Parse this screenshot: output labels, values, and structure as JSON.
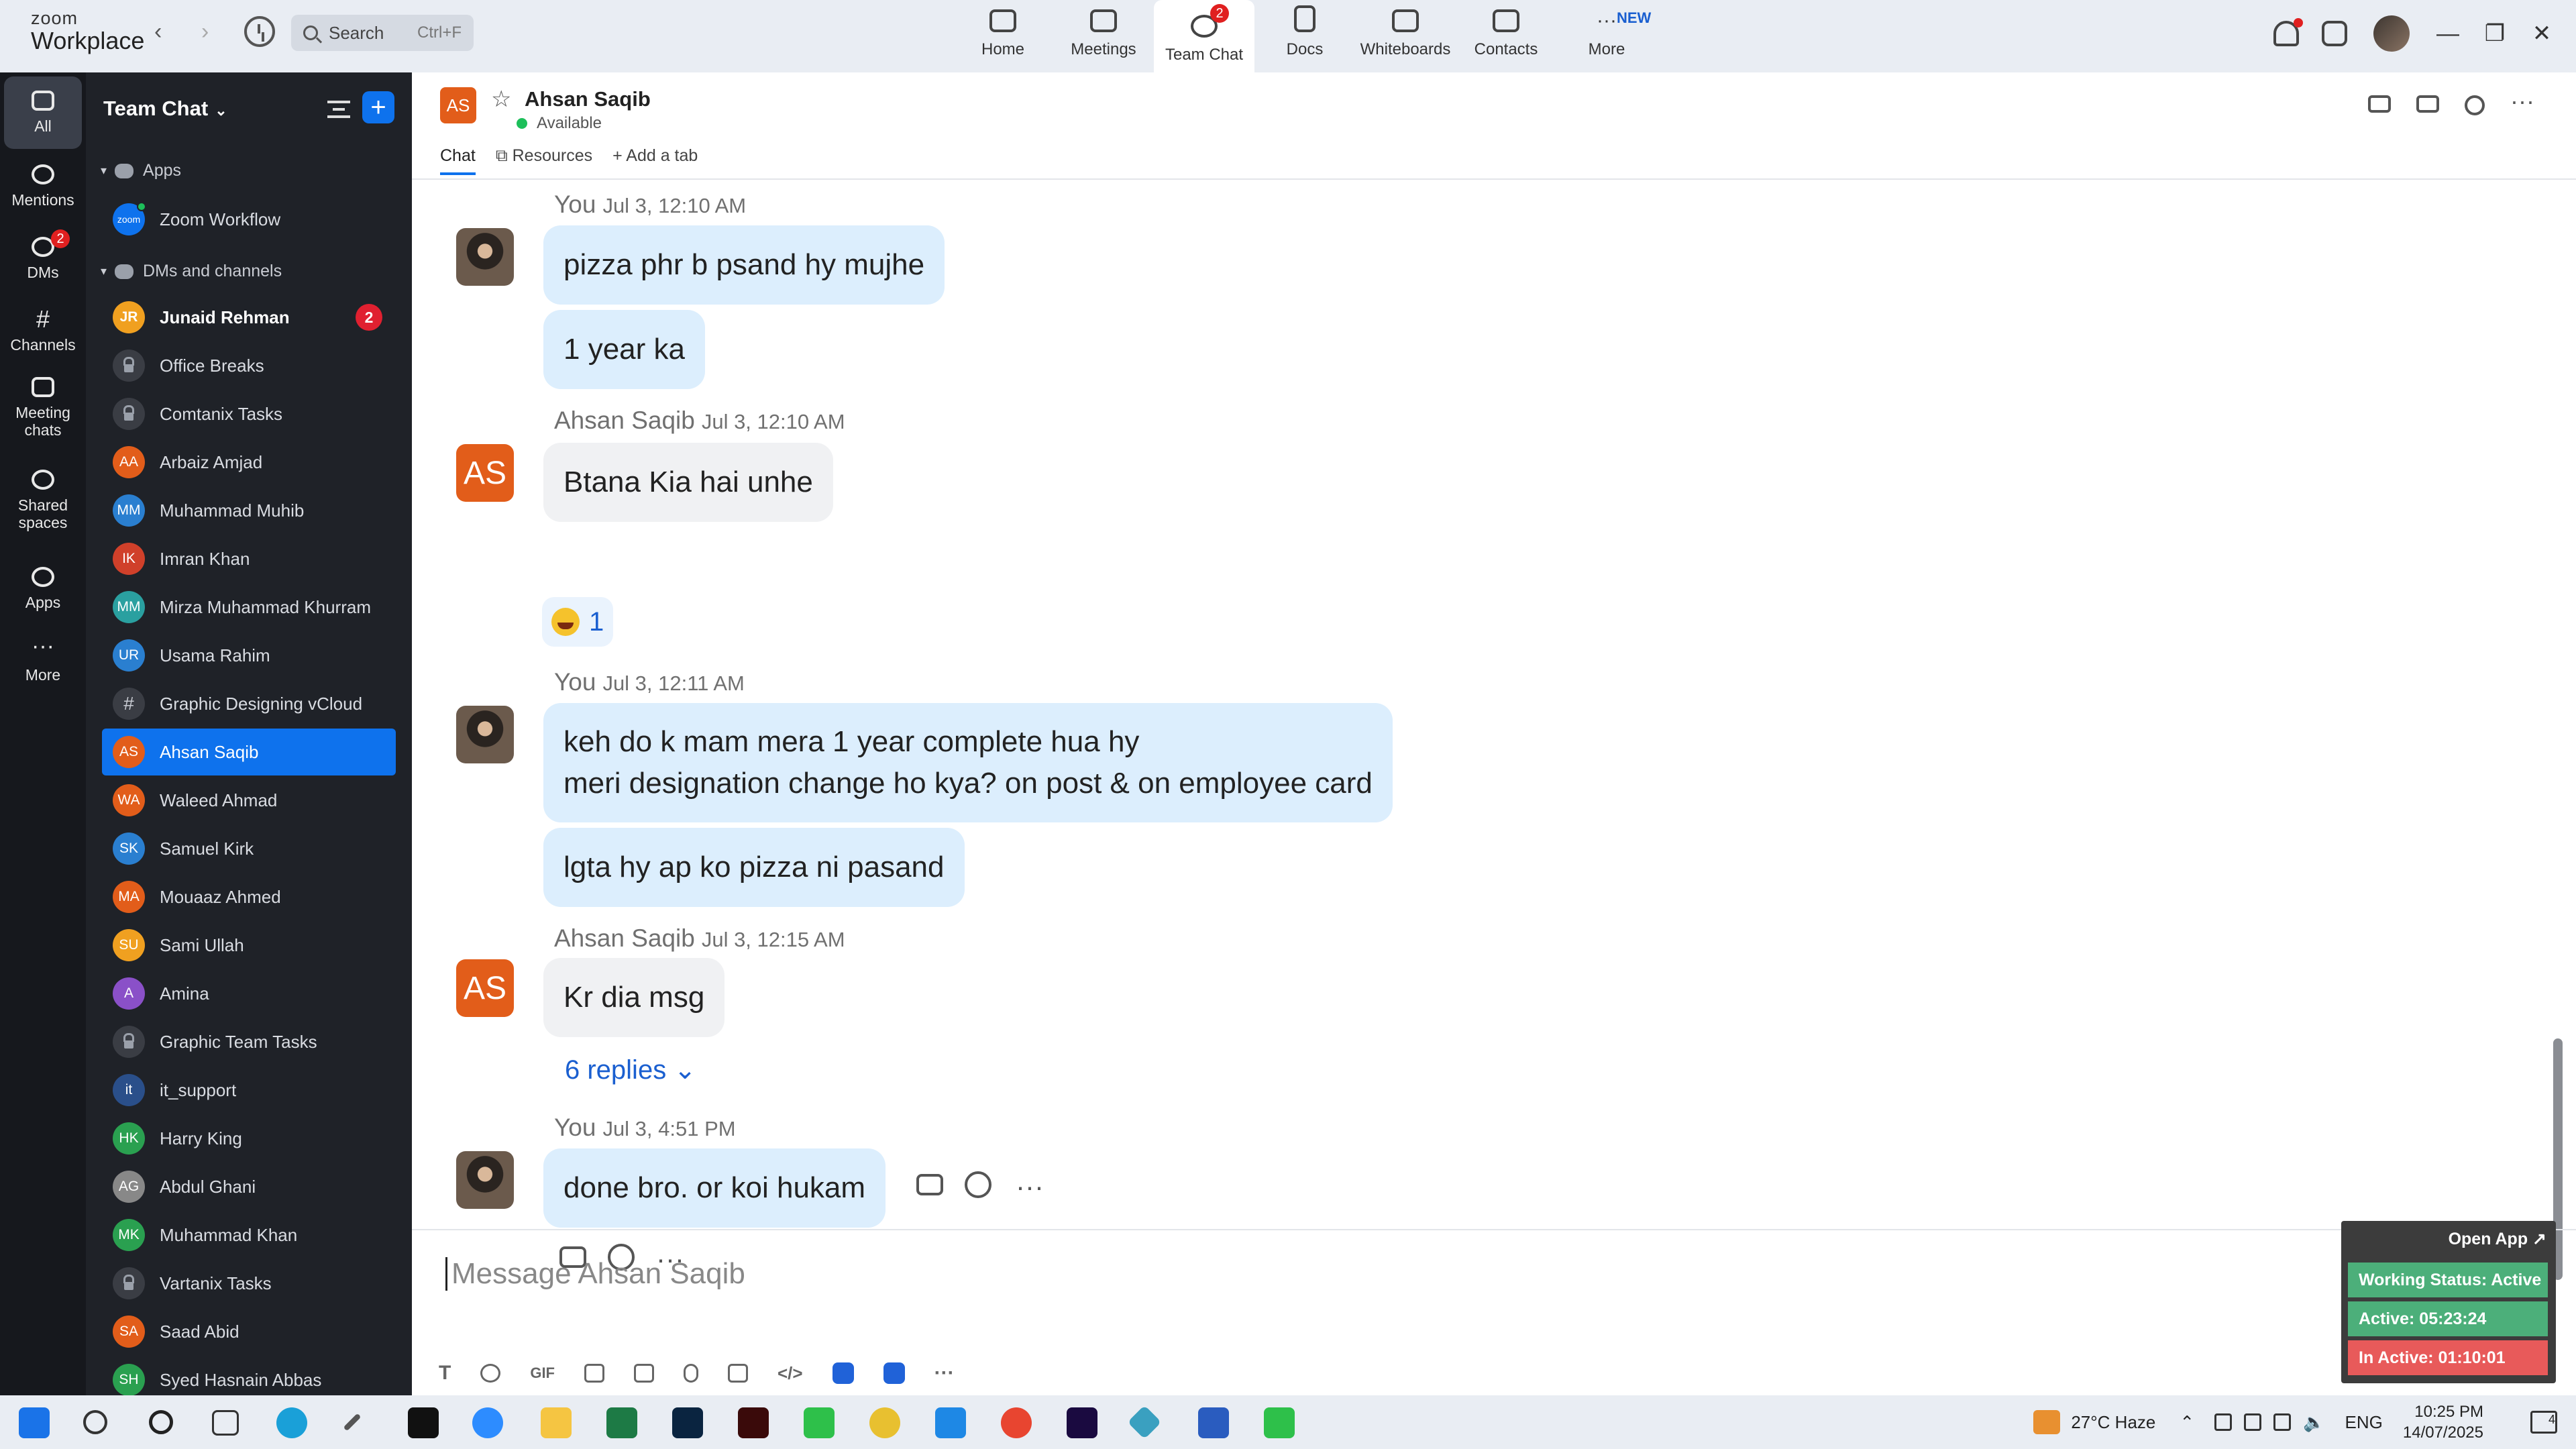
{
  "app": {
    "brand_small": "zoom",
    "brand_large": "Workplace"
  },
  "search": {
    "label": "Search",
    "shortcut": "Ctrl+F"
  },
  "top_tabs": [
    {
      "label": "Home"
    },
    {
      "label": "Meetings"
    },
    {
      "label": "Team Chat",
      "badge": "2"
    },
    {
      "label": "Docs"
    },
    {
      "label": "Whiteboards"
    },
    {
      "label": "Contacts"
    },
    {
      "label": "More",
      "badge": "NEW"
    }
  ],
  "rail": [
    {
      "label": "All"
    },
    {
      "label": "Mentions"
    },
    {
      "label": "DMs",
      "badge": "2"
    },
    {
      "label": "Channels"
    },
    {
      "label": "Meeting chats"
    },
    {
      "label": "Shared spaces"
    },
    {
      "label": "Apps"
    },
    {
      "label": "More"
    }
  ],
  "sidebar": {
    "title": "Team Chat",
    "section_apps": "Apps",
    "app_item": "Zoom Workflow",
    "section_dms": "DMs and channels",
    "items": [
      {
        "name": "Junaid Rehman",
        "initials": "JR",
        "color": "#f0a020",
        "badge": "2"
      },
      {
        "name": "Office Breaks",
        "initials": "",
        "color": "lock"
      },
      {
        "name": "Comtanix Tasks",
        "initials": "",
        "color": "lock"
      },
      {
        "name": "Arbaiz Amjad",
        "initials": "AA",
        "color": "#e25d1a"
      },
      {
        "name": "Muhammad Muhib",
        "initials": "MM",
        "color": "#2a7fd0"
      },
      {
        "name": "Imran Khan",
        "initials": "IK",
        "color": "#d0402a"
      },
      {
        "name": "Mirza Muhammad Khurram",
        "initials": "MM",
        "color": "#2aa0a0"
      },
      {
        "name": "Usama Rahim",
        "initials": "UR",
        "color": "#2a7fd0"
      },
      {
        "name": "Graphic Designing vCloud",
        "initials": "#",
        "color": "hash"
      },
      {
        "name": "Ahsan Saqib",
        "initials": "AS",
        "color": "#e25d1a"
      },
      {
        "name": "Waleed Ahmad",
        "initials": "WA",
        "color": "#e25d1a"
      },
      {
        "name": "Samuel Kirk",
        "initials": "SK",
        "color": "#2a7fd0"
      },
      {
        "name": "Mouaaz Ahmed",
        "initials": "MA",
        "color": "#e25d1a"
      },
      {
        "name": "Sami Ullah",
        "initials": "SU",
        "color": "#f0a020"
      },
      {
        "name": "Amina",
        "initials": "A",
        "color": "#8a50c8"
      },
      {
        "name": "Graphic Team Tasks",
        "initials": "",
        "color": "lock"
      },
      {
        "name": "it_support",
        "initials": "it",
        "color": "#2a4f8a"
      },
      {
        "name": "Harry King",
        "initials": "HK",
        "color": "#2aa050"
      },
      {
        "name": "Abdul Ghani",
        "initials": "AG",
        "color": "#888"
      },
      {
        "name": "Muhammad Khan",
        "initials": "MK",
        "color": "#2aa050"
      },
      {
        "name": "Vartanix Tasks",
        "initials": "",
        "color": "lock"
      },
      {
        "name": "Saad Abid",
        "initials": "SA",
        "color": "#e25d1a"
      },
      {
        "name": "Syed Hasnain Abbas",
        "initials": "SH",
        "color": "#2aa050"
      }
    ]
  },
  "chat": {
    "contact": "Ahsan Saqib",
    "initials": "AS",
    "status": "Available",
    "tab_chat": "Chat",
    "tab_resources": "Resources",
    "tab_add": "Add a tab",
    "messages": [
      {
        "sender": "You",
        "time": "Jul 3, 12:10 AM",
        "lines": [
          "pizza phr b psand hy mujhe"
        ]
      },
      {
        "sender": "",
        "time": "",
        "lines": [
          "1 year ka"
        ]
      },
      {
        "sender": "Ahsan Saqib",
        "time": "Jul 3, 12:10 AM",
        "lines": [
          "Btana Kia hai unhe"
        ],
        "reaction": "1"
      },
      {
        "sender": "You",
        "time": "Jul 3, 12:11 AM",
        "lines": [
          "keh do k mam mera 1 year complete hua hy",
          "meri designation change ho kya? on post & on employee card"
        ]
      },
      {
        "sender": "",
        "time": "",
        "lines": [
          "lgta hy ap ko pizza ni pasand"
        ]
      },
      {
        "sender": "Ahsan Saqib",
        "time": "Jul 3, 12:15 AM",
        "lines": [
          "Kr dia msg"
        ],
        "replies": "6 replies"
      },
      {
        "sender": "You",
        "time": "Jul 3, 4:51 PM",
        "lines": [
          "done bro. or koi hukam"
        ]
      }
    ],
    "compose_placeholder": "Message Ahsan Saqib",
    "gif_label": "GIF"
  },
  "widget": {
    "open_app": "Open App ↗",
    "working": "Working Status: Active",
    "active": "Active: 05:23:24",
    "inactive": "In Active: 01:10:01",
    "colors": {
      "working": "#4caf7a",
      "active": "#4caf7a",
      "inactive": "#e85a5a"
    }
  },
  "taskbar": {
    "weather": "27°C Haze",
    "lang": "ENG",
    "time": "10:25 PM",
    "date": "14/07/2025",
    "notif": "4"
  }
}
